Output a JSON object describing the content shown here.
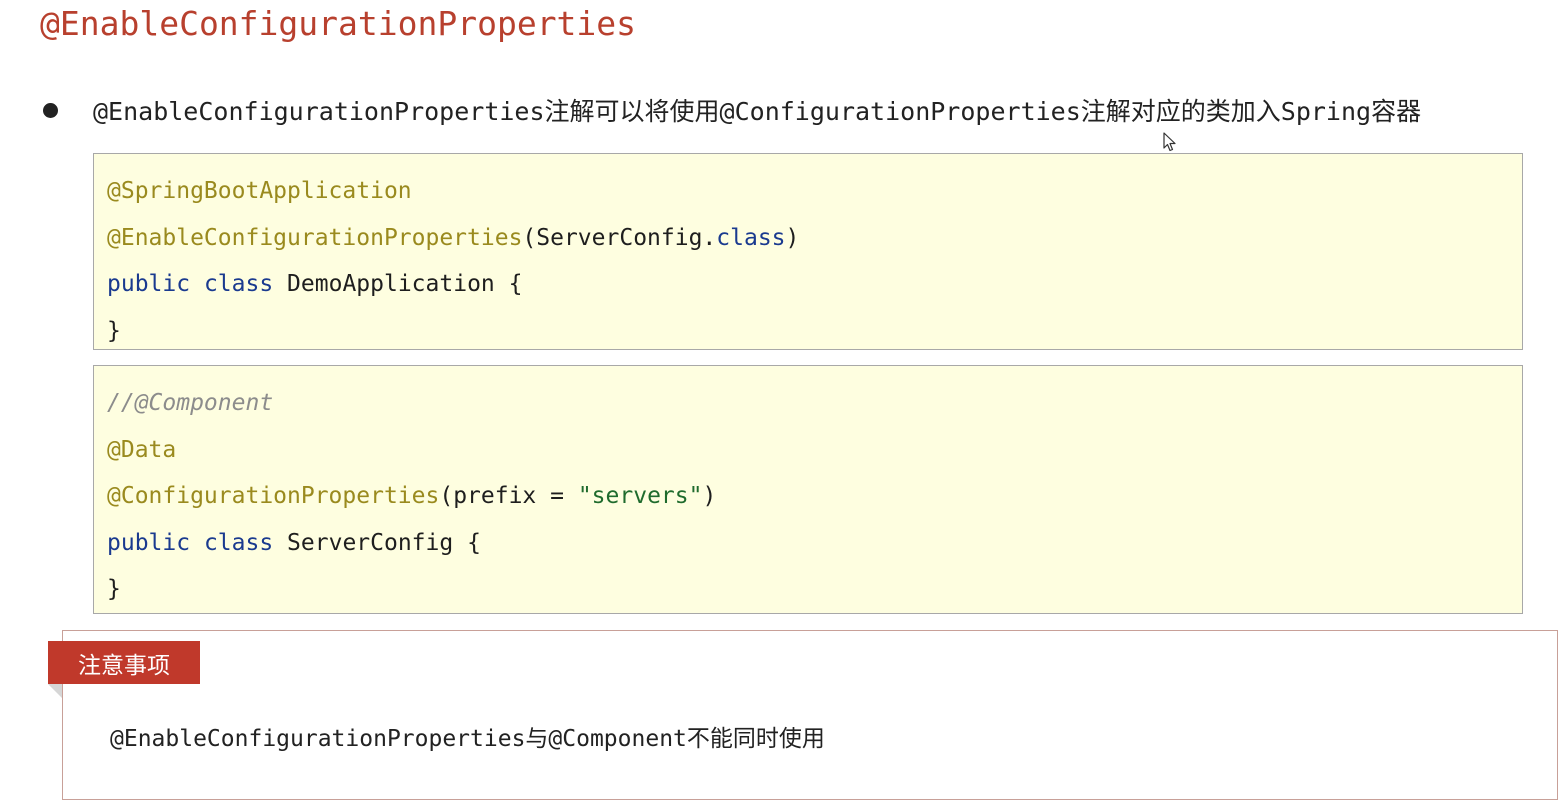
{
  "title": "@EnableConfigurationProperties",
  "bullet": {
    "text": "@EnableConfigurationProperties注解可以将使用@ConfigurationProperties注解对应的类加入Spring容器"
  },
  "code_block_1": {
    "line1_annotation": "@SpringBootApplication",
    "line2_annotation": "@EnableConfigurationProperties",
    "line2_open": "(ServerConfig.",
    "line2_class_kw": "class",
    "line2_close": ")",
    "line3_public": "public",
    "line3_class": "class",
    "line3_name": " DemoApplication {",
    "line4": "}"
  },
  "code_block_2": {
    "line1_comment": "//@Component",
    "line2_annotation": "@Data",
    "line3_annotation": "@ConfigurationProperties",
    "line3_open": "(prefix = ",
    "line3_string": "\"servers\"",
    "line3_close": ")",
    "line4_public": "public",
    "line4_class": "class",
    "line4_name": " ServerConfig {",
    "line5": "}"
  },
  "note": {
    "tag": "注意事项",
    "text": "@EnableConfigurationProperties与@Component不能同时使用"
  },
  "colors": {
    "title": "#b8402e",
    "annotation": "#9a8a1e",
    "keyword": "#1a3a8f",
    "string": "#1f6b2d",
    "comment": "#8c8c8c",
    "code_background": "#fefee0",
    "note_tag": "#c0392b"
  },
  "icons": {
    "cursor": "mouse-pointer-icon",
    "bullet": "bullet-dot-icon"
  }
}
